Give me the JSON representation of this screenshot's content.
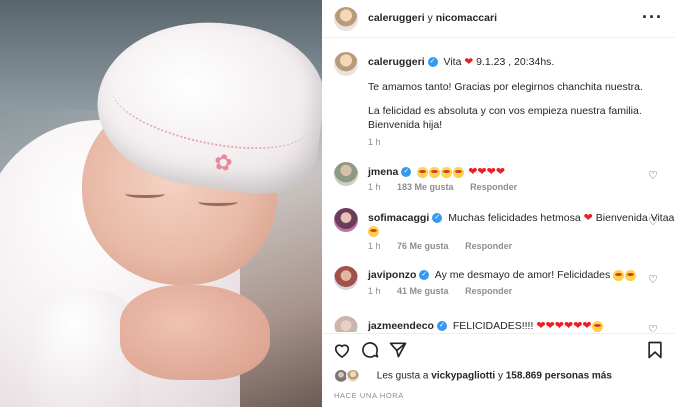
{
  "header": {
    "user1": "caleruggeri",
    "connector": "y",
    "user2": "nicomaccari",
    "more_icon": "more-horizontal-icon"
  },
  "caption": {
    "username": "caleruggeri",
    "text_line1_prefix": "Vita",
    "date": "9.1.23 , 20:34hs.",
    "line2": "Te amamos tanto! Gracias por elegirnos chanchita nuestra.",
    "line3": "La felicidad es absoluta y con vos empieza nuestra familia. Bienvenida hija!",
    "time": "1 h"
  },
  "comments": [
    {
      "username": "jmena",
      "text": "",
      "time": "1 h",
      "likes": "183 Me gusta",
      "reply": "Responder"
    },
    {
      "username": "sofimacaggi",
      "text": "Muchas felicidades hetmosa",
      "text_after": "Bienvenida Vitaa",
      "time": "1 h",
      "likes": "76 Me gusta",
      "reply": "Responder"
    },
    {
      "username": "javiponzo",
      "text": "Ay me desmayo de amor! Felicidades",
      "time": "1 h",
      "likes": "41 Me gusta",
      "reply": "Responder"
    },
    {
      "username": "jazmeendeco",
      "text": "FELICIDADES!!!!"
    }
  ],
  "likes_summary": {
    "prefix": "Les gusta a",
    "user": "vickypagliotti",
    "middle": "y",
    "count": "158.869 personas más"
  },
  "posted_ago": "HACE UNA HORA",
  "icons": [
    "heart-icon",
    "comment-icon",
    "share-icon",
    "bookmark-icon",
    "verified-icon"
  ]
}
